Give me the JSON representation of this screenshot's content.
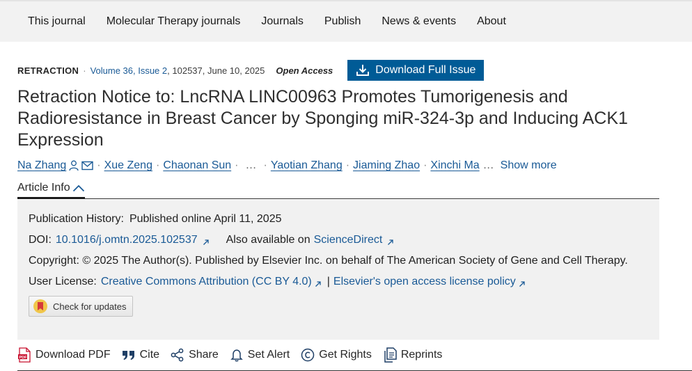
{
  "topnav": {
    "items": [
      "This journal",
      "Molecular Therapy journals",
      "Journals",
      "Publish",
      "News & events",
      "About"
    ]
  },
  "meta": {
    "article_type": "RETRACTION",
    "volume_issue": "Volume 36, Issue 2",
    "article_number_date": "102537, June 10, 2025",
    "open_access": "Open Access",
    "download_issue_label": "Download Full Issue"
  },
  "title": "Retraction Notice to: LncRNA LINC00963 Promotes Tumorigenesis and Radioresistance in Breast Cancer by Sponging miR-324-3p and Inducing ACK1 Expression",
  "authors": {
    "list": [
      "Na Zhang",
      "Xue Zeng",
      "Chaonan Sun",
      "Yaotian Zhang",
      "Jiaming Zhao",
      "Xinchi Ma"
    ],
    "ellipsis": "…",
    "show_more": "Show more"
  },
  "article_info": {
    "tab_label": "Article Info",
    "pub_history_label": "Publication History:",
    "pub_history_value": "Published online April 11, 2025",
    "doi_label": "DOI:",
    "doi_value": "10.1016/j.omtn.2025.102537",
    "also_available": "Also available on",
    "sciencedirect": "ScienceDirect",
    "copyright": "Copyright: © 2025 The Author(s). Published by Elsevier Inc. on behalf of The American Society of Gene and Cell Therapy.",
    "license_label": "User License:",
    "license_link": "Creative Commons Attribution (CC BY 4.0)",
    "license_sep": "|",
    "policy_link": "Elsevier's open access license policy",
    "check_updates": "Check for updates"
  },
  "actions": {
    "download_pdf": "Download PDF",
    "cite": "Cite",
    "share": "Share",
    "set_alert": "Set Alert",
    "get_rights": "Get Rights",
    "reprints": "Reprints"
  },
  "colors": {
    "link": "#1a5a96",
    "button_bg": "#005b96",
    "nav_bg": "#f2f2f2",
    "panel_bg": "#f1f1f1",
    "pdf_red": "#c8102e"
  },
  "icons": [
    "person-icon",
    "envelope-icon",
    "download-icon",
    "chevron-up-icon",
    "external-link-icon",
    "pdf-icon",
    "quote-icon",
    "share-icon",
    "bell-icon",
    "copyright-icon",
    "reprints-icon",
    "crossmark-icon"
  ]
}
